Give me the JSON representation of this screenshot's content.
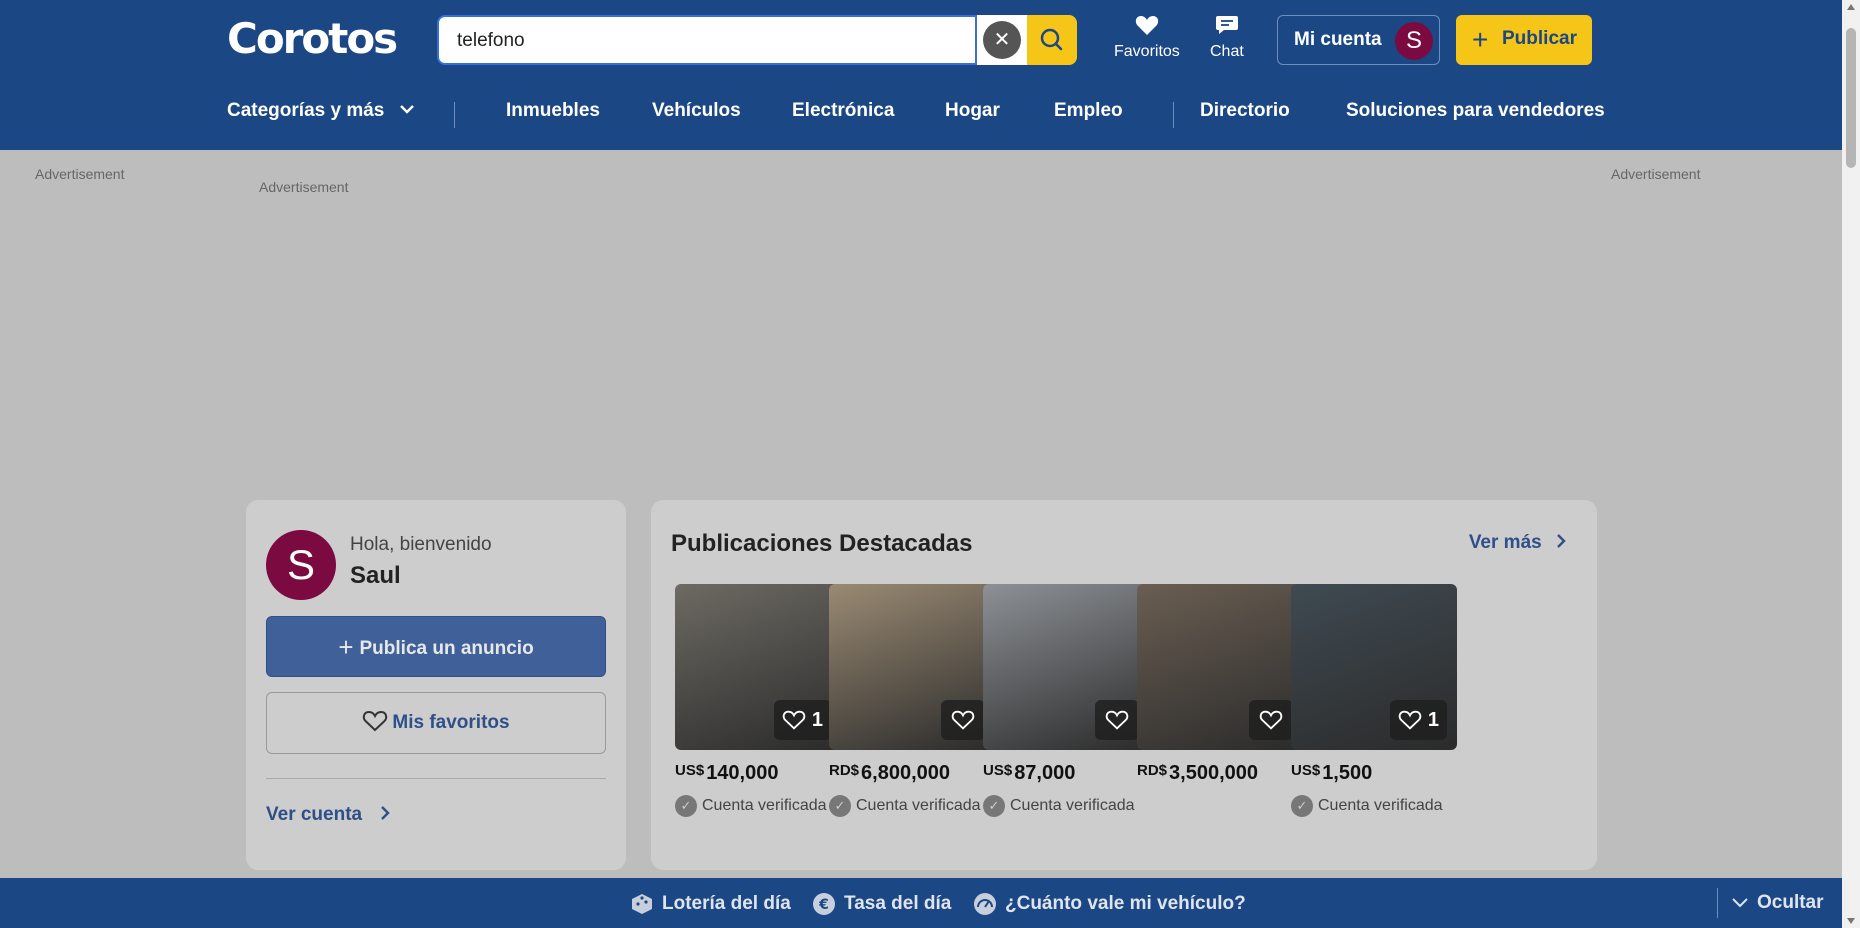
{
  "header": {
    "logo": "Corotos",
    "search_value": "telefono",
    "favoritos_label": "Favoritos",
    "chat_label": "Chat",
    "account_label": "Mi cuenta",
    "avatar_initial": "S",
    "publish_label": "Publicar"
  },
  "nav": {
    "categories": "Categorías y más",
    "items": [
      "Inmuebles",
      "Vehículos",
      "Electrónica",
      "Hogar",
      "Empleo"
    ],
    "directory": "Directorio",
    "sellers": "Soluciones para vendedores"
  },
  "ads": {
    "left": "Advertisement",
    "center": "Advertisement",
    "right": "Advertisement"
  },
  "user_card": {
    "avatar_initial": "S",
    "greeting": "Hola, bienvenido",
    "name": "Saul",
    "publish_ad": "Publica un anuncio",
    "favorites": "Mis favoritos",
    "view_account": "Ver cuenta"
  },
  "featured": {
    "title": "Publicaciones Destacadas",
    "see_more": "Ver más",
    "listings": [
      {
        "currency": "US$",
        "price": "140,000",
        "favorites": "1",
        "verified": "Cuenta verificada",
        "thumb_color": "#6d6a63"
      },
      {
        "currency": "RD$",
        "price": "6,800,000",
        "favorites": "",
        "verified": "Cuenta verificada",
        "thumb_color": "#9a8a73"
      },
      {
        "currency": "US$",
        "price": "87,000",
        "favorites": "",
        "verified": "Cuenta verificada",
        "thumb_color": "#8d9196"
      },
      {
        "currency": "RD$",
        "price": "3,500,000",
        "favorites": "",
        "verified": "",
        "thumb_color": "#6a5e52"
      },
      {
        "currency": "US$",
        "price": "1,500",
        "favorites": "1",
        "verified": "Cuenta verificada",
        "thumb_color": "#3f4a52"
      }
    ]
  },
  "footer": {
    "lottery": "Lotería del día",
    "rate": "Tasa del día",
    "vehicle_value": "¿Cuánto vale mi vehículo?",
    "hide": "Ocultar"
  },
  "colors": {
    "brand_blue": "#1b4784",
    "accent_yellow": "#f5c518",
    "avatar": "#7a0a3f"
  }
}
